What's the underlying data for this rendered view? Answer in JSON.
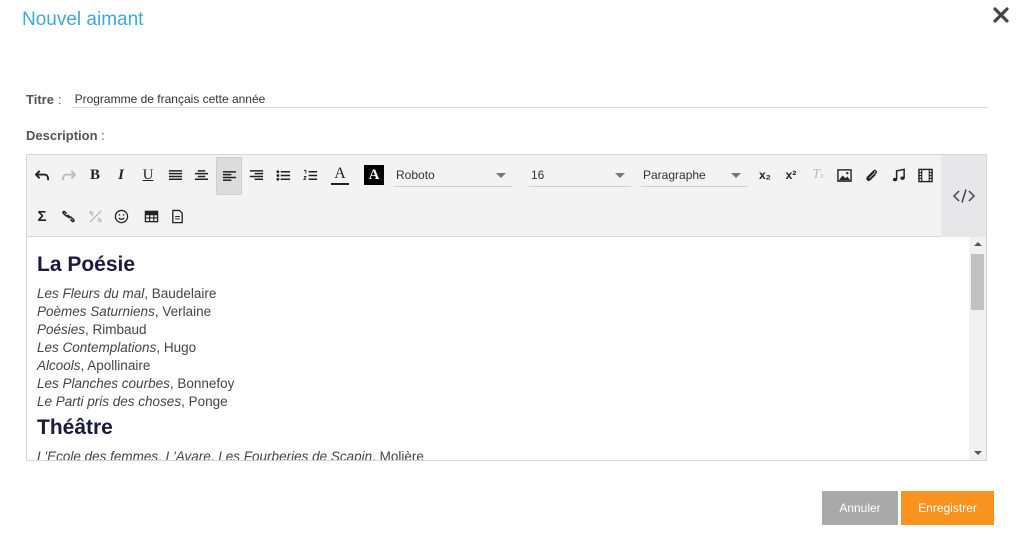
{
  "dialog": {
    "title": "Nouvel aimant"
  },
  "form": {
    "title_label": "Titre",
    "title_sep": ":",
    "title_value": "Programme de français cette année",
    "description_label": "Description",
    "description_sep": ":"
  },
  "toolbar": {
    "font_family": "Roboto",
    "font_size": "16",
    "block_format": "Paragraphe",
    "bold_label": "B",
    "italic_label": "I",
    "underline_label": "U",
    "sigma_label": "Σ",
    "subscript_label": "x₂",
    "superscript_label": "x²",
    "text_color_label": "A",
    "bg_color_label": "A",
    "clear_format_label": "T"
  },
  "content": {
    "heading1": "La Poésie",
    "poetry": [
      {
        "work": "Les Fleurs du mal",
        "author": ", Baudelaire"
      },
      {
        "work": "Poèmes Saturniens",
        "author": ", Verlaine"
      },
      {
        "work": "Poésies",
        "author": ", Rimbaud"
      },
      {
        "work": "Les Contemplations",
        "author": ", Hugo"
      },
      {
        "work": "Alcools",
        "author": ", Apollinaire"
      },
      {
        "work": "Les Planches courbes",
        "author": ", Bonnefoy"
      },
      {
        "work": "Le Parti pris des choses",
        "author": ", Ponge"
      }
    ],
    "heading2": "Théâtre",
    "theatre_line": {
      "work1": "L'Ecole des femmes",
      "sep1": ", ",
      "work2": "L'Avare",
      "sep2": ", ",
      "work3": "Les Fourberies de Scapin",
      "author": ", Molière"
    }
  },
  "buttons": {
    "cancel": "Annuler",
    "save": "Enregistrer"
  },
  "colors": {
    "title_blue": "#3fa9d6",
    "save_orange": "#f7931e",
    "cancel_gray": "#a9a9a9"
  }
}
